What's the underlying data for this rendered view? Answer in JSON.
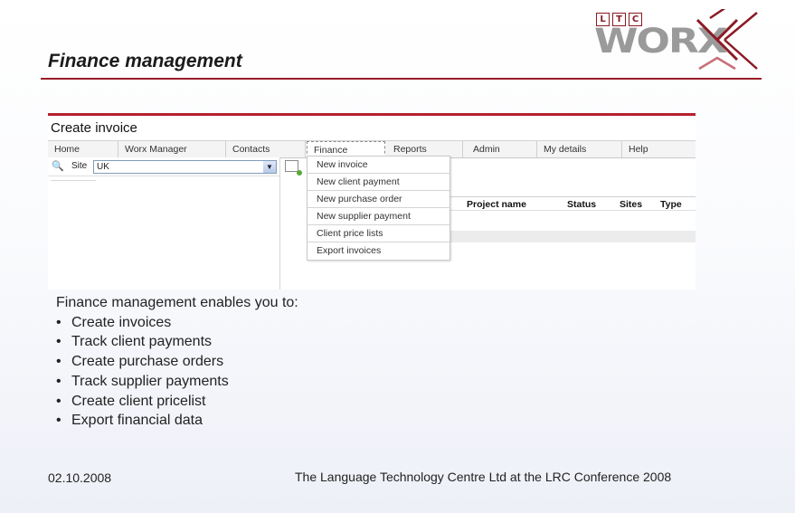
{
  "slide": {
    "title": "Finance management",
    "footer_date": "02.10.2008",
    "footer_text": "The Language Technology Centre Ltd at the LRC Conference 2008"
  },
  "logo": {
    "letters": [
      "L",
      "T",
      "C"
    ],
    "wordmark": "WORX",
    "colors": {
      "accent": "#8b1a24",
      "gray": "#9a9a9a"
    }
  },
  "app": {
    "page_title": "Create invoice",
    "nav": [
      {
        "label": "Home"
      },
      {
        "label": "Worx Manager"
      },
      {
        "label": "Contacts"
      },
      {
        "label": "Finance",
        "active": true
      },
      {
        "label": "Reports"
      },
      {
        "label": "Admin"
      },
      {
        "label": "My details"
      },
      {
        "label": "Help"
      }
    ],
    "toolbar": {
      "site_label": "Site",
      "site_value": "UK"
    },
    "finance_menu": [
      "New invoice",
      "New client payment",
      "New purchase order",
      "New supplier payment",
      "Client price lists",
      "Export invoices"
    ],
    "table_headers": [
      "Project name",
      "Status",
      "Sites",
      "Type"
    ]
  },
  "content": {
    "intro": "Finance management enables you to:",
    "bullets": [
      "Create invoices",
      "Track client payments",
      "Create purchase orders",
      "Track supplier payments",
      "Create client pricelist",
      "Export financial data"
    ]
  },
  "colors": {
    "accent": "#9b1b26",
    "app_bar": "#b5202e"
  }
}
